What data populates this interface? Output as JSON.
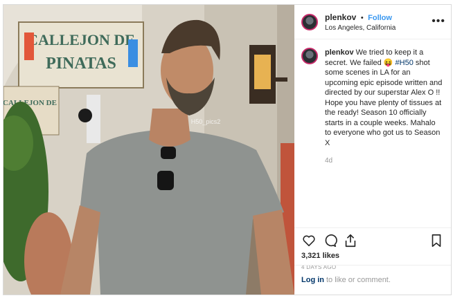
{
  "post": {
    "username": "plenkov",
    "separator": "•",
    "follow_label": "Follow",
    "location": "Los Angeles, California",
    "more_label": "•••",
    "caption": {
      "username": "plenkov",
      "text_before": "We tried to keep it a secret. We failed 😝 ",
      "hashtag": "#H50",
      "text_after": " shot some scenes in LA for an upcoming epic episode written and directed by our superstar Alex O !! Hope you have plenty of tissues at the ready! Season 10 officially starts in a couple weeks. Mahalo to everyone who got us to Season X"
    },
    "time_short": "4d",
    "likes": "3,321 likes",
    "time_long": "4 DAYS AGO",
    "login_link": "Log in",
    "login_rest": "to like or comment."
  },
  "photo": {
    "sign_text_1": "CALLEJON DE",
    "sign_text_2": "PINATAS",
    "sign_small_1": "CALLEJON DE",
    "watermark": "H50_pics2"
  },
  "colors": {
    "link_blue": "#3897f0",
    "hashtag_blue": "#003569",
    "muted": "#999999",
    "border": "#dbdbdb"
  },
  "icons": [
    "heart-icon",
    "comment-icon",
    "share-icon",
    "bookmark-icon",
    "more-icon"
  ]
}
